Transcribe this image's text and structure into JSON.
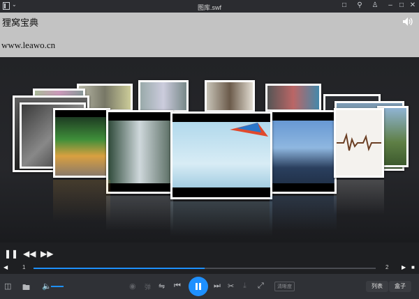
{
  "window": {
    "title": "图库.swf",
    "menu_icon": "app-menu-icon",
    "controls": [
      "message-icon",
      "pin-icon",
      "skin-icon",
      "minimize-icon",
      "maximize-icon",
      "close-icon"
    ]
  },
  "banner": {
    "title": "狸窝宝典",
    "url": "www.leawo.cn"
  },
  "gallery": {
    "cards": [
      "tea-cup",
      "waterfall",
      "sky-robots",
      "lighthouse",
      "heartbeat-line",
      "mountain",
      "photo-friends-1",
      "photo-friends-2",
      "photo-woman",
      "photo-street",
      "photo-small"
    ]
  },
  "player": {
    "track_start": "1",
    "track_end": "2",
    "progress": 0.5,
    "quality_label": "清晰度",
    "danmaku_label": "弹",
    "list_label": "列表",
    "box_label": "盒子"
  },
  "colors": {
    "accent": "#1e90ff",
    "banner_bg": "#c3c3c3",
    "bottom_bg": "#2f3136"
  }
}
